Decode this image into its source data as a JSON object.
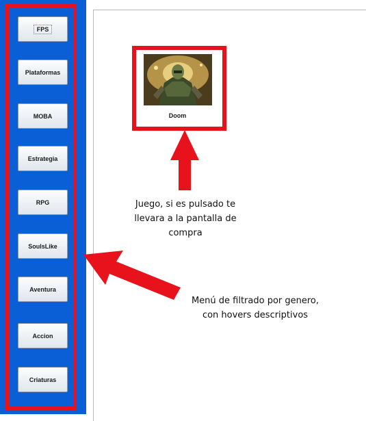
{
  "sidebar": {
    "genres": [
      "FPS",
      "Plataformas",
      "MOBA",
      "Estrategia",
      "RPG",
      "SoulsLike",
      "Aventura",
      "Accion",
      "Criaturas"
    ]
  },
  "game_card": {
    "title": "Doom",
    "image_icon": "doom-slayer-image"
  },
  "annotations": {
    "game_note": [
      "Juego, si es pulsado te",
      "llevara a la pantalla de",
      "compra"
    ],
    "menu_note": [
      "Menú de filtrado por genero,",
      "con hovers descriptivos"
    ]
  },
  "colors": {
    "sidebar_bg": "#0b5fd6",
    "highlight": "#e8121d",
    "arrow": "#e8121d"
  }
}
